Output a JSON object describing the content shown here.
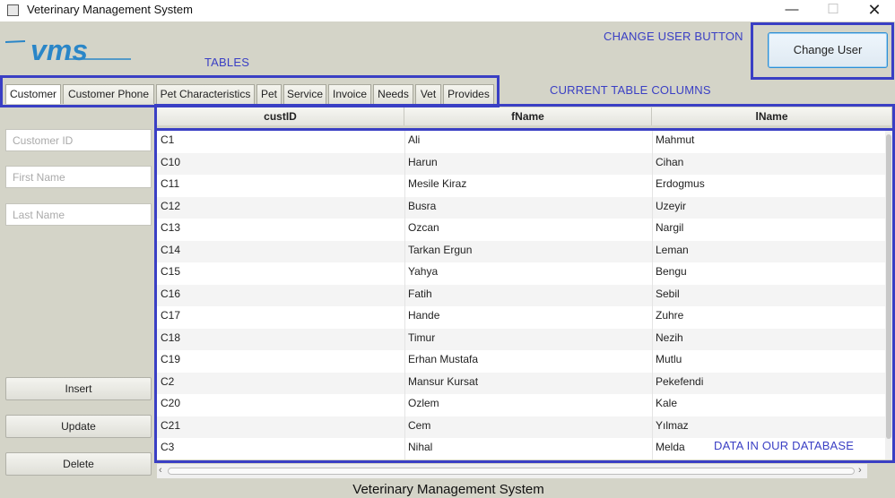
{
  "window": {
    "title": "Veterinary Management System",
    "minimize": "—",
    "maximize": "☐",
    "close": "✕"
  },
  "logo": {
    "text": "vms",
    "color": "#2a86c8"
  },
  "annotations": {
    "tables": "TABLES",
    "change_user": "CHANGE USER BUTTON",
    "columns": "CURRENT TABLE COLUMNS",
    "data": "DATA IN OUR DATABASE",
    "color": "#3a3fc4"
  },
  "change_user_button": "Change User",
  "tabs": [
    {
      "label": "Customer",
      "active": true
    },
    {
      "label": "Customer Phone",
      "active": false
    },
    {
      "label": "Pet Characteristics",
      "active": false
    },
    {
      "label": "Pet",
      "active": false
    },
    {
      "label": "Service",
      "active": false
    },
    {
      "label": "Invoice",
      "active": false
    },
    {
      "label": "Needs",
      "active": false
    },
    {
      "label": "Vet",
      "active": false
    },
    {
      "label": "Provides",
      "active": false
    }
  ],
  "form": {
    "customer_id_placeholder": "Customer ID",
    "first_name_placeholder": "First Name",
    "last_name_placeholder": "Last Name",
    "insert": "Insert",
    "update": "Update",
    "delete": "Delete"
  },
  "table": {
    "columns": [
      "custID",
      "fName",
      "lName"
    ],
    "rows": [
      [
        "C1",
        "Ali",
        "Mahmut"
      ],
      [
        "C10",
        "Harun",
        "Cihan"
      ],
      [
        "C11",
        "Mesile Kiraz",
        "Erdogmus"
      ],
      [
        "C12",
        "Busra",
        "Uzeyir"
      ],
      [
        "C13",
        "Ozcan",
        "Nargil"
      ],
      [
        "C14",
        "Tarkan Ergun",
        "Leman"
      ],
      [
        "C15",
        "Yahya",
        "Bengu"
      ],
      [
        "C16",
        "Fatih",
        "Sebil"
      ],
      [
        "C17",
        "Hande",
        "Zuhre"
      ],
      [
        "C18",
        "Timur",
        "Nezih"
      ],
      [
        "C19",
        "Erhan Mustafa",
        "Mutlu"
      ],
      [
        "C2",
        "Mansur Kursat",
        "Pekefendi"
      ],
      [
        "C20",
        "Ozlem",
        "Kale"
      ],
      [
        "C21",
        "Cem",
        "Yılmaz"
      ],
      [
        "C3",
        "Nihal",
        "Melda"
      ]
    ]
  },
  "footer": "Veterinary Management System"
}
